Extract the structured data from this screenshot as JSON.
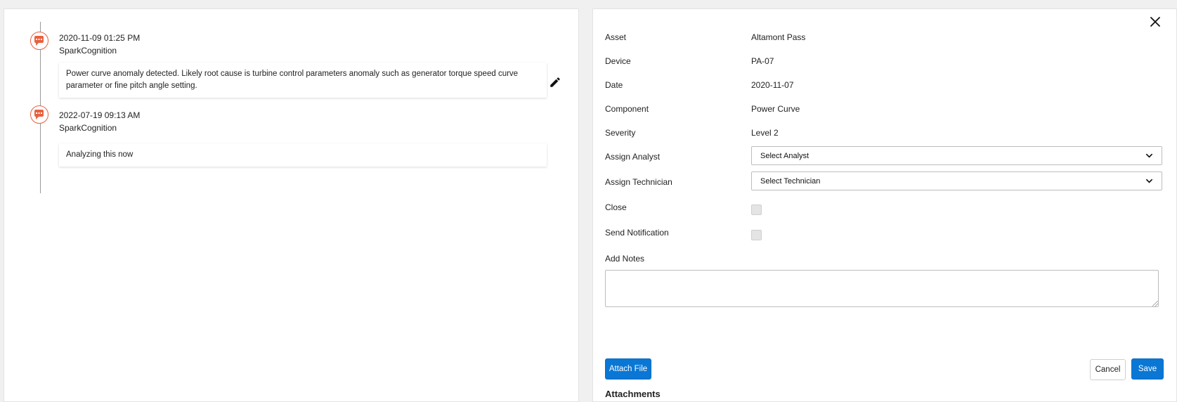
{
  "timeline": {
    "entries": [
      {
        "date": "2020-11-09 01:25 PM",
        "author": "SparkCognition",
        "message": "Power curve anomaly detected. Likely root cause is turbine control parameters anomaly such as generator torque speed curve parameter or fine pitch angle setting."
      },
      {
        "date": "2022-07-19 09:13 AM",
        "author": "SparkCognition",
        "message": "Analyzing this now"
      }
    ],
    "icon": "chat-bubble-icon",
    "icon_color": "#e9603f"
  },
  "form": {
    "fields": {
      "asset": {
        "label": "Asset",
        "value": "Altamont Pass"
      },
      "device": {
        "label": "Device",
        "value": "PA-07"
      },
      "date": {
        "label": "Date",
        "value": "2020-11-07"
      },
      "component": {
        "label": "Component",
        "value": "Power Curve"
      },
      "severity": {
        "label": "Severity",
        "value": "Level 2"
      }
    },
    "assign_analyst": {
      "label": "Assign Analyst",
      "selected": "Select Analyst"
    },
    "assign_technician": {
      "label": "Assign Technician",
      "selected": "Select Technician"
    },
    "close": {
      "label": "Close"
    },
    "send_notification": {
      "label": "Send Notification"
    },
    "notes": {
      "label": "Add Notes",
      "value": ""
    },
    "buttons": {
      "attach_file": "Attach File",
      "cancel": "Cancel",
      "save": "Save"
    },
    "attachments_label": "Attachments"
  },
  "colors": {
    "primary": "#0a77d5",
    "accent": "#e9603f"
  }
}
